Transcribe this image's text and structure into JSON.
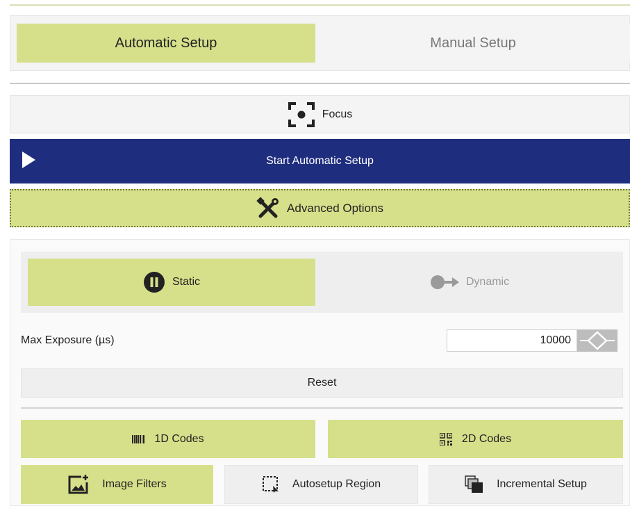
{
  "setup_tabs": {
    "automatic": "Automatic Setup",
    "manual": "Manual Setup"
  },
  "focus": {
    "label": "Focus",
    "icon": "focus-target-icon"
  },
  "start": {
    "label": "Start Automatic Setup",
    "icon": "play-icon"
  },
  "advanced": {
    "label": "Advanced Options",
    "icon": "tools-icon"
  },
  "mode": {
    "static_label": "Static",
    "dynamic_label": "Dynamic",
    "static_icon": "pause-circle-icon",
    "dynamic_icon": "motion-arrow-icon"
  },
  "exposure": {
    "label": "Max Exposure (µs)",
    "value": "10000"
  },
  "reset": {
    "label": "Reset"
  },
  "codes": {
    "one_d": "1D Codes",
    "two_d": "2D Codes",
    "one_d_icon": "barcode-icon",
    "two_d_icon": "qr-code-icon"
  },
  "tools": {
    "image_filters": "Image Filters",
    "autosetup_region": "Autosetup Region",
    "incremental_setup": "Incremental Setup"
  },
  "colors": {
    "accent": "#d6e08a",
    "primary": "#1f2d7e",
    "panel": "#f4f4f4"
  }
}
